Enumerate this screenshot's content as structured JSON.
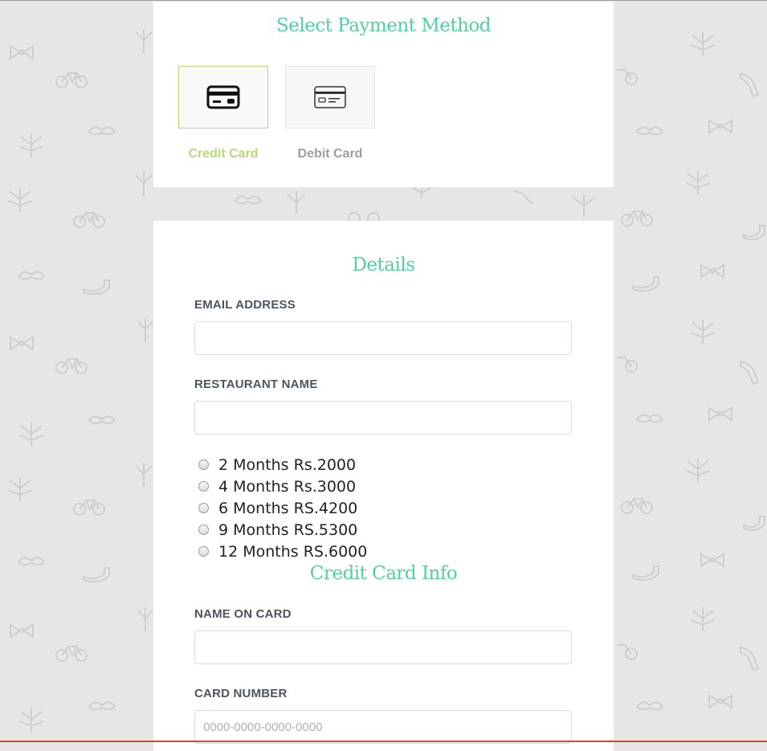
{
  "payment_method": {
    "title": "Select Payment Method",
    "options": [
      {
        "label": "Credit Card",
        "icon": "credit-card-icon",
        "selected": true
      },
      {
        "label": "Debit Card",
        "icon": "debit-card-icon",
        "selected": false
      }
    ]
  },
  "details": {
    "title": "Details",
    "email_label": "EMAIL ADDRESS",
    "email_value": "",
    "restaurant_label": "RESTAURANT NAME",
    "restaurant_value": "",
    "plans": [
      "2 Months Rs.2000",
      "4 Months Rs.3000",
      "6 Months RS.4200",
      "9 Months RS.5300",
      "12 Months RS.6000"
    ]
  },
  "card_info": {
    "title": "Credit Card Info",
    "name_label": "NAME ON CARD",
    "name_value": "",
    "number_label": "CARD NUMBER",
    "number_placeholder": "0000-0000-0000-0000"
  },
  "colors": {
    "accent_green": "#4fd1a0",
    "selected_lime": "#b7da72",
    "background": "#e6e6e6",
    "bottom_rule": "#c94c3a"
  }
}
